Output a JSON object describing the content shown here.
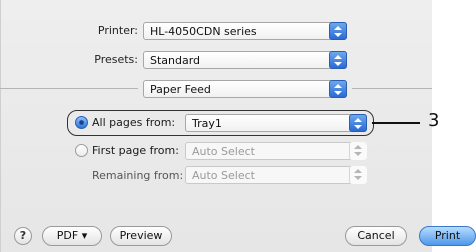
{
  "dialog": {
    "printer": {
      "label": "Printer:",
      "value": "HL-4050CDN series"
    },
    "presets": {
      "label": "Presets:",
      "value": "Standard"
    },
    "panel": {
      "value": "Paper Feed"
    }
  },
  "paper_feed": {
    "all_pages": {
      "label": "All pages from:",
      "value": "Tray1",
      "selected": true
    },
    "first_page": {
      "label": "First page from:",
      "value": "Auto Select",
      "selected": false
    },
    "remaining": {
      "label": "Remaining from:",
      "value": "Auto Select"
    }
  },
  "callout": {
    "number": "3"
  },
  "footer": {
    "help_label": "?",
    "pdf_label": "PDF ▾",
    "preview_label": "Preview",
    "cancel_label": "Cancel",
    "print_label": "Print"
  }
}
